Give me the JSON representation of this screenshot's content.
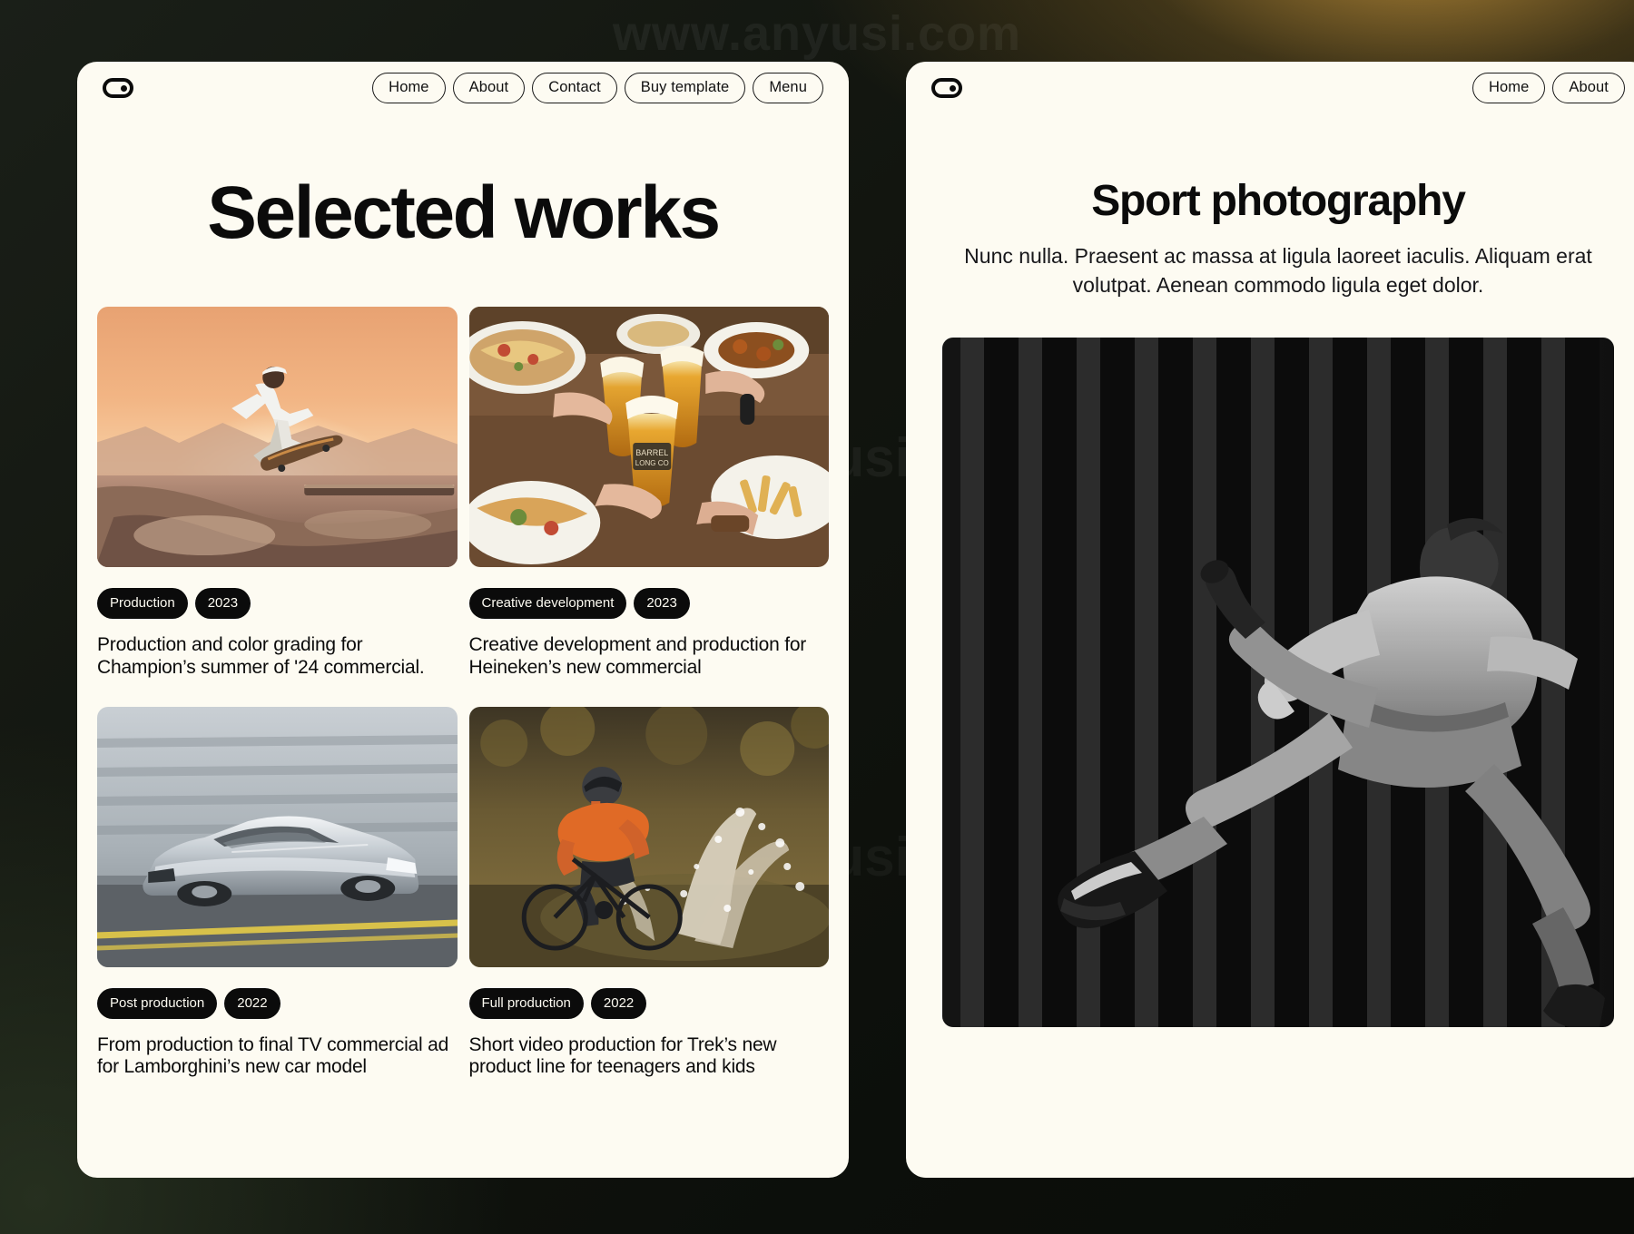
{
  "background": {
    "watermark_text": "www.anyusi.com",
    "dark_color": "#12150f",
    "accent_gold": "#c8963c"
  },
  "works_page": {
    "logo_name": "brand-logo",
    "nav": [
      {
        "label": "Home"
      },
      {
        "label": "About"
      },
      {
        "label": "Contact"
      },
      {
        "label": "Buy template"
      },
      {
        "label": "Menu"
      }
    ],
    "title": "Selected works",
    "cards": [
      {
        "image_name": "skateboarder-sunset-photo",
        "tags": [
          "Production",
          "2023"
        ],
        "caption": "Production and color grading for Champion’s summer of '24 commercial."
      },
      {
        "image_name": "beer-cheers-table-photo",
        "tags": [
          "Creative development",
          "2023"
        ],
        "caption": "Creative development and production for Heineken’s new commercial"
      },
      {
        "image_name": "silver-supercar-photo",
        "tags": [
          "Post production",
          "2022"
        ],
        "caption": "From production to final TV commercial ad for Lamborghini’s new car model"
      },
      {
        "image_name": "mountain-biker-splash-photo",
        "tags": [
          "Full production",
          "2022"
        ],
        "caption": "Short video production for Trek’s new product line for teenagers and kids"
      }
    ]
  },
  "sport_page": {
    "logo_name": "brand-logo",
    "nav": [
      {
        "label": "Home"
      },
      {
        "label": "About"
      }
    ],
    "title": "Sport photography",
    "subtitle": "Nunc nulla. Praesent ac massa at ligula laoreet iaculis. Aliquam erat volutpat. Aenean commodo ligula eget dolor.",
    "hero_image_name": "parkour-runner-bw-photo"
  },
  "colors": {
    "paper": "#fdfbf2",
    "ink": "#0b0b0b",
    "tag_bg": "#0b0b0b",
    "tag_text": "#fdfbf2"
  }
}
